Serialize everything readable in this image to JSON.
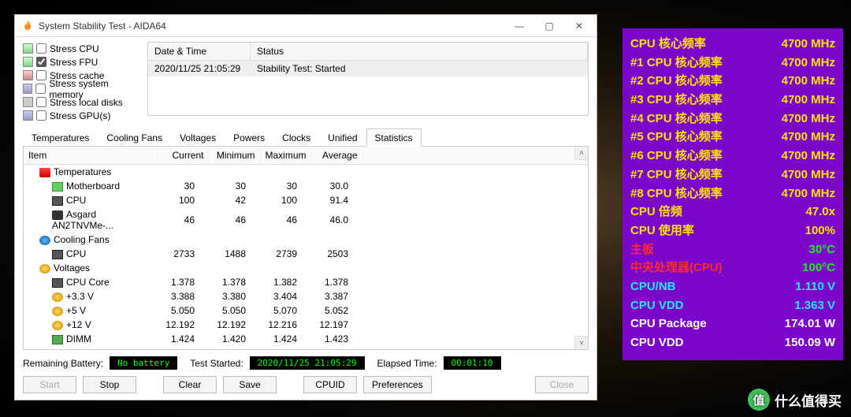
{
  "title": "System Stability Test - AIDA64",
  "stress": {
    "cpu": "Stress CPU",
    "fpu": "Stress FPU",
    "cache": "Stress cache",
    "mem": "Stress system memory",
    "disk": "Stress local disks",
    "gpu": "Stress GPU(s)"
  },
  "log": {
    "h_date": "Date & Time",
    "h_status": "Status",
    "r_date": "2020/11/25 21:05:29",
    "r_status": "Stability Test: Started"
  },
  "tabs": [
    "Temperatures",
    "Cooling Fans",
    "Voltages",
    "Powers",
    "Clocks",
    "Unified",
    "Statistics"
  ],
  "gridHead": [
    "Item",
    "Current",
    "Minimum",
    "Maximum",
    "Average"
  ],
  "sections": {
    "temps": "Temperatures",
    "fans": "Cooling Fans",
    "volts": "Voltages"
  },
  "rows": {
    "mb": {
      "n": "Motherboard",
      "c": "30",
      "mi": "30",
      "ma": "30",
      "a": "30.0"
    },
    "cpu": {
      "n": "CPU",
      "c": "100",
      "mi": "42",
      "ma": "100",
      "a": "91.4"
    },
    "nvme": {
      "n": "Asgard AN2TNVMe-...",
      "c": "46",
      "mi": "46",
      "ma": "46",
      "a": "46.0"
    },
    "fan": {
      "n": "CPU",
      "c": "2733",
      "mi": "1488",
      "ma": "2739",
      "a": "2503"
    },
    "vcore": {
      "n": "CPU Core",
      "c": "1.378",
      "mi": "1.378",
      "ma": "1.382",
      "a": "1.378"
    },
    "v33": {
      "n": "+3.3 V",
      "c": "3.388",
      "mi": "3.380",
      "ma": "3.404",
      "a": "3.387"
    },
    "v5": {
      "n": "+5 V",
      "c": "5.050",
      "mi": "5.050",
      "ma": "5.070",
      "a": "5.052"
    },
    "v12": {
      "n": "+12 V",
      "c": "12.192",
      "mi": "12.192",
      "ma": "12.216",
      "a": "12.197"
    },
    "dimm": {
      "n": "DIMM",
      "c": "1.424",
      "mi": "1.420",
      "ma": "1.424",
      "a": "1.423"
    }
  },
  "status": {
    "battlbl": "Remaining Battery:",
    "batt": "No battery",
    "startlbl": "Test Started:",
    "start": "2020/11/25 21:05:29",
    "elaplbl": "Elapsed Time:",
    "elap": "00:01:10"
  },
  "btns": {
    "start": "Start",
    "stop": "Stop",
    "clear": "Clear",
    "save": "Save",
    "cpuid": "CPUID",
    "pref": "Preferences",
    "close": "Close"
  },
  "hw": [
    {
      "l": "CPU 核心频率",
      "v": "4700 MHz",
      "lc": "yl",
      "vc": "yl"
    },
    {
      "l": "#1 CPU 核心频率",
      "v": "4700 MHz",
      "lc": "yl",
      "vc": "yl"
    },
    {
      "l": "#2 CPU 核心频率",
      "v": "4700 MHz",
      "lc": "yl",
      "vc": "yl"
    },
    {
      "l": "#3 CPU 核心频率",
      "v": "4700 MHz",
      "lc": "yl",
      "vc": "yl"
    },
    {
      "l": "#4 CPU 核心频率",
      "v": "4700 MHz",
      "lc": "yl",
      "vc": "yl"
    },
    {
      "l": "#5 CPU 核心频率",
      "v": "4700 MHz",
      "lc": "yl",
      "vc": "yl"
    },
    {
      "l": "#6 CPU 核心频率",
      "v": "4700 MHz",
      "lc": "yl",
      "vc": "yl"
    },
    {
      "l": "#7 CPU 核心频率",
      "v": "4700 MHz",
      "lc": "yl",
      "vc": "yl"
    },
    {
      "l": "#8 CPU 核心频率",
      "v": "4700 MHz",
      "lc": "yl",
      "vc": "yl"
    },
    {
      "l": "CPU 倍频",
      "v": "47.0x",
      "lc": "yl",
      "vc": "yl"
    },
    {
      "l": "CPU 使用率",
      "v": "100%",
      "lc": "yl",
      "vc": "yl"
    },
    {
      "l": "主板",
      "v": "30°C",
      "lc": "rd",
      "vc": "gr"
    },
    {
      "l": "中央处理器(CPU)",
      "v": "100°C",
      "lc": "rd",
      "vc": "gr"
    },
    {
      "l": "CPU/NB",
      "v": "1.110 V",
      "lc": "cy",
      "vc": "cy"
    },
    {
      "l": "CPU VDD",
      "v": "1.363 V",
      "lc": "cy",
      "vc": "cy"
    },
    {
      "l": "CPU Package",
      "v": "174.01 W",
      "lc": "wt",
      "vc": "wt"
    },
    {
      "l": "CPU VDD",
      "v": "150.09 W",
      "lc": "wt",
      "vc": "wt"
    }
  ],
  "watermark": "什么值得买"
}
